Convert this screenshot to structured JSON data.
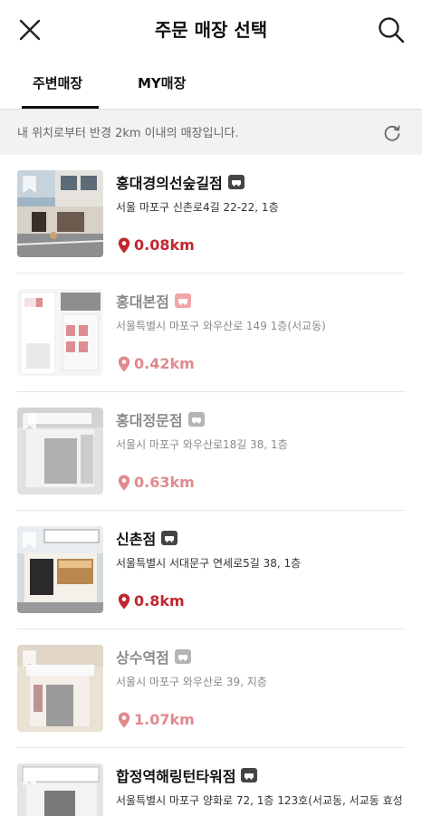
{
  "header": {
    "title": "주문 매장 선택"
  },
  "tabs": [
    {
      "label": "주변매장",
      "active": true
    },
    {
      "label": "MY매장",
      "active": false
    }
  ],
  "info_bar": {
    "message": "내 위치로부터 반경 2km 이내의 매장입니다."
  },
  "colors": {
    "distance_active": "#c0282f",
    "distance_dim": "#e08a8e",
    "info_bar_bg": "#f2f2f2"
  },
  "stores": [
    {
      "name": "홍대경의선숲길점",
      "address": "서울 마포구 신촌로4길 22-22, 1층",
      "distance": "0.08km",
      "available": true
    },
    {
      "name": "홍대본점",
      "address": "서울특별시 마포구 와우산로 149 1층(서교동)",
      "distance": "0.42km",
      "available": false
    },
    {
      "name": "홍대정문점",
      "address": "서울시 마포구 와우산로18길 38, 1층",
      "distance": "0.63km",
      "available": false
    },
    {
      "name": "신촌점",
      "address": "서울특별시 서대문구 연세로5길 38, 1층",
      "distance": "0.8km",
      "available": true
    },
    {
      "name": "상수역점",
      "address": "서울시 마포구 와우산로 39, 지층",
      "distance": "1.07km",
      "available": false
    },
    {
      "name": "합정역해링턴타워점",
      "address": "서울특별시 마포구 양화로 72, 1층 123호(서교동, 서교동 효성",
      "distance": "",
      "available": true
    }
  ]
}
